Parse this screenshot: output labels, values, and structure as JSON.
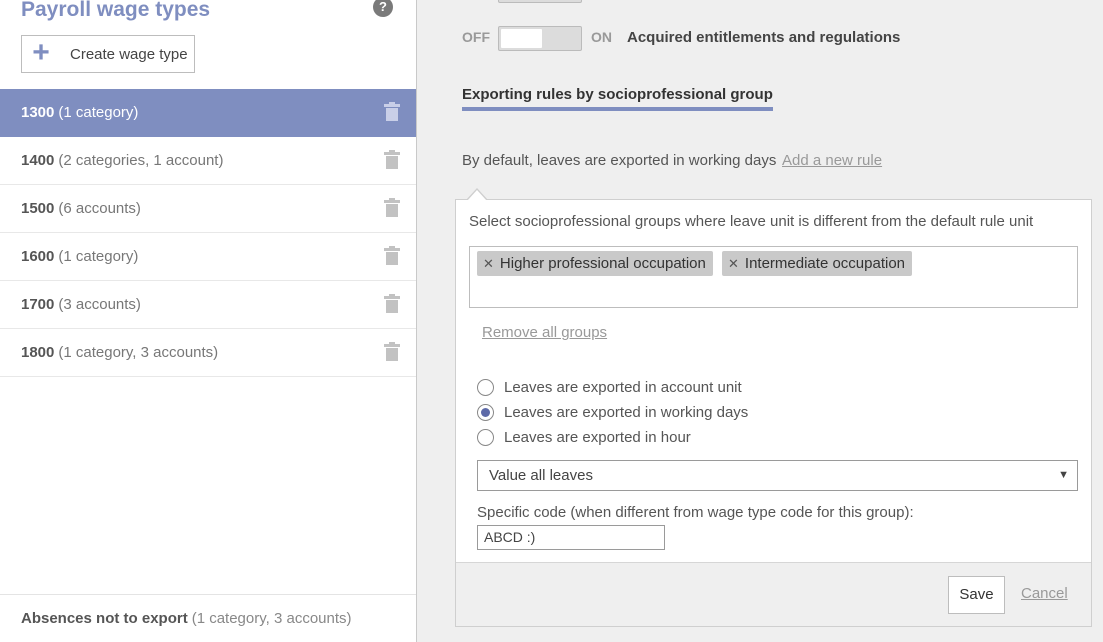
{
  "left_panel": {
    "title": "Payroll wage types",
    "help_icon": "question-icon",
    "create_button": "Create wage type",
    "wage_types": [
      {
        "code": "1300",
        "detail": "(1 category)",
        "selected": true
      },
      {
        "code": "1400",
        "detail": "(2 categories, 1 account)",
        "selected": false
      },
      {
        "code": "1500",
        "detail": "(6 accounts)",
        "selected": false
      },
      {
        "code": "1600",
        "detail": "(1 category)",
        "selected": false
      },
      {
        "code": "1700",
        "detail": "(3 accounts)",
        "selected": false
      },
      {
        "code": "1800",
        "detail": "(1 category, 3 accounts)",
        "selected": false
      }
    ],
    "absences": {
      "name": "Absences not to export",
      "detail": "(1 category, 3 accounts)"
    }
  },
  "main": {
    "toggle": {
      "off_label": "OFF",
      "on_label": "ON",
      "state": "OFF",
      "label": "Acquired entitlements and regulations"
    },
    "section_title": "Exporting rules by socioprofessional group",
    "default_rule": "By default, leaves are exported in working days",
    "add_rule_link": "Add a new rule",
    "rule": {
      "select_label": "Select socioprofessional groups where leave unit is different from the default rule unit",
      "groups": [
        "Higher professional occupation",
        "Intermediate occupation"
      ],
      "remove_all_link": "Remove all groups",
      "radio_options": [
        {
          "label": "Leaves are exported in account unit",
          "checked": false
        },
        {
          "label": "Leaves are exported in working days",
          "checked": true
        },
        {
          "label": "Leaves are exported in hour",
          "checked": false
        }
      ],
      "dropdown_value": "Value all leaves",
      "code_label": "Specific code (when different from wage type code for this group):",
      "code_value": "ABCD :)"
    },
    "save_button": "Save",
    "cancel_link": "Cancel"
  },
  "colors": {
    "accent": "#7f8ec0",
    "radio_checked": "#5d6aa8"
  }
}
